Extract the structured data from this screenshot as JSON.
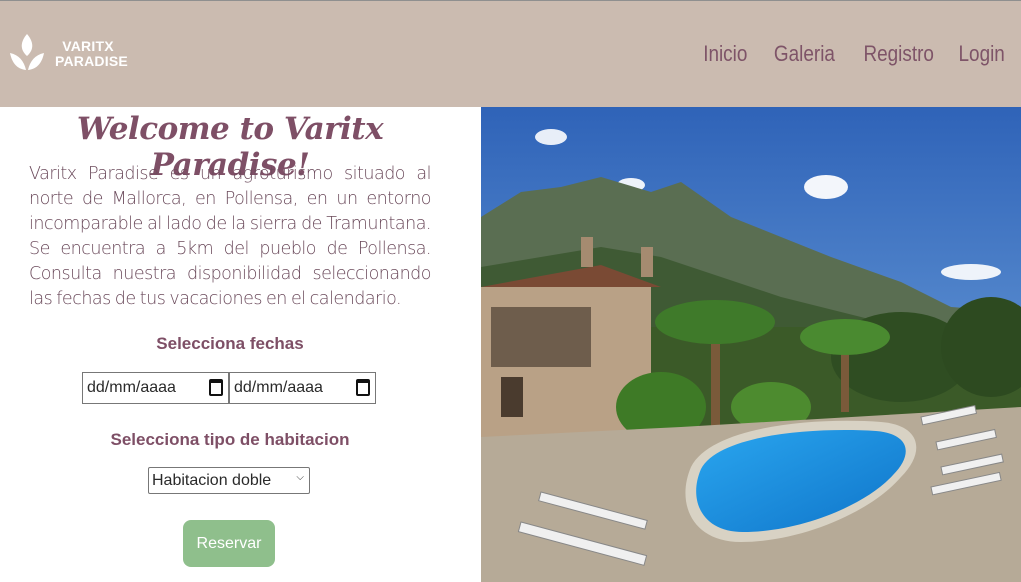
{
  "header": {
    "brand_line1": "VARITX",
    "brand_line2": "PARADISE",
    "nav": [
      "Inicio",
      "Galeria",
      "Registro",
      "Login"
    ],
    "background": "#cbbbb0",
    "nav_color": "#7e5468"
  },
  "main": {
    "title": "Welcome to Varitx Paradise!",
    "intro": "Varitx Paradise es un agroturismo situado al norte de Mallorca, en Pollensa, en un entorno incomparable al lado de la sierra de Tramuntana. Se encuentra a 5km del pueblo de Pollensa. Consulta nuestra disponibilidad seleccionando las fechas de tus vacaciones en el calendario.",
    "dates_label": "Selecciona fechas",
    "date_from_placeholder": "dd/mm/aaaa",
    "date_to_placeholder": "dd/mm/aaaa",
    "room_label": "Selecciona tipo de habitacion",
    "room_selected": "Habitacion doble",
    "reserve_button": "Reservar",
    "button_color": "#8fbf8c"
  },
  "icons": {
    "logo": "leaf-logo-icon",
    "calendar": "calendar-icon",
    "dropdown": "chevron-down-icon"
  }
}
